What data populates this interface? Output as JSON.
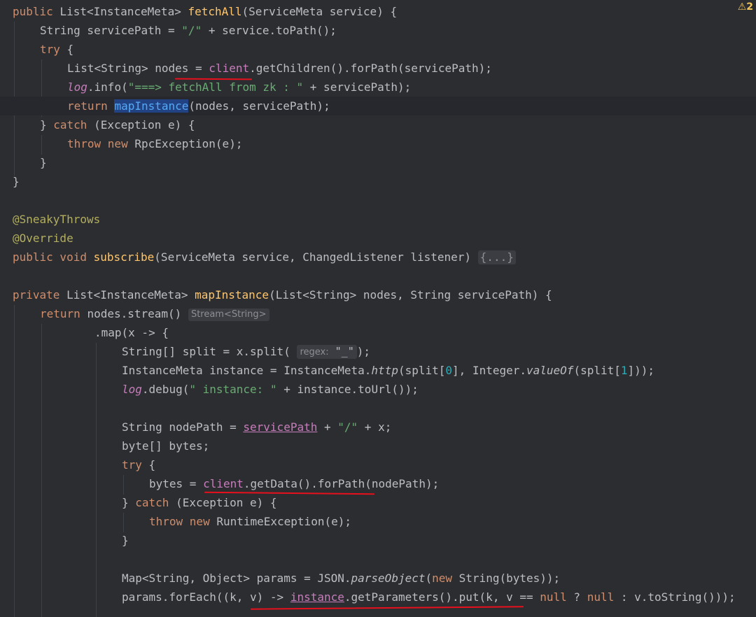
{
  "warning_icon_label": "⚠",
  "warning_count": "2",
  "code": {
    "l1": [
      "public ",
      "List",
      "<InstanceMeta> ",
      "fetchAll",
      "(ServiceMeta service) {"
    ],
    "l2": [
      "String servicePath = ",
      "\"/\"",
      " + service.toPath();"
    ],
    "l3": [
      "try",
      " {"
    ],
    "l4": [
      "List<String> nodes = ",
      "client",
      ".getChildren().forPath(servicePath);"
    ],
    "l5": [
      "log",
      ".info(",
      "\"===> fetchAll from zk : \"",
      " + servicePath);"
    ],
    "l6": [
      "return ",
      "mapInstance",
      "(nodes, servicePath);"
    ],
    "l7": [
      "} ",
      "catch",
      " (Exception e) {"
    ],
    "l8": [
      "throw new ",
      "RpcException(e);"
    ],
    "l9": [
      "}"
    ],
    "l10": [
      "}"
    ],
    "l12": [
      "@SneakyThrows"
    ],
    "l13": [
      "@Override"
    ],
    "l14": [
      "public void ",
      "subscribe",
      "(ServiceMeta service, ChangedListener listener) ",
      "{...}"
    ],
    "l16": [
      "private ",
      "List<InstanceMeta> ",
      "mapInstance",
      "(List<String> nodes, String servicePath) {"
    ],
    "l17": [
      "return ",
      "nodes.stream() ",
      "Stream<String>"
    ],
    "l18": [
      ".map(x -> {"
    ],
    "l19": [
      "String[] split = x.split( ",
      "regex:",
      " \"_\"",
      ");"
    ],
    "l20": [
      "InstanceMeta instance = InstanceMeta.",
      "http",
      "(split[",
      "0",
      "], Integer.",
      "valueOf",
      "(split[",
      "1",
      "]));"
    ],
    "l21": [
      "log",
      ".debug(",
      "\" instance: \"",
      " + instance.toUrl());"
    ],
    "l23": [
      "String nodePath = ",
      "servicePath",
      " + ",
      "\"/\"",
      " + x;"
    ],
    "l24": [
      "byte[] bytes;"
    ],
    "l25": [
      "try",
      " {"
    ],
    "l26": [
      "bytes = ",
      "client",
      ".getData().forPath(nodePath);"
    ],
    "l27": [
      "} ",
      "catch",
      " (Exception e) {"
    ],
    "l28": [
      "throw new ",
      "RuntimeException(e);"
    ],
    "l29": [
      "}"
    ],
    "l31": [
      "Map<String, Object> params = JSON.",
      "parseObject",
      "(",
      "new ",
      "String(bytes));"
    ],
    "l32": [
      "params.forEach((k, v) -> ",
      "instance",
      ".getParameters().put(k, v == ",
      "null",
      " ? ",
      "null",
      " : v.toString()));"
    ]
  }
}
